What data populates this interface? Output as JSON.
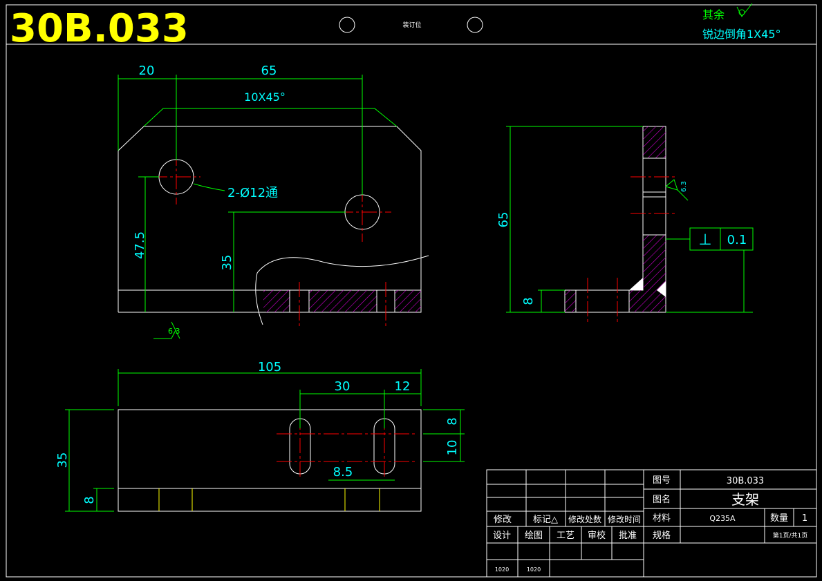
{
  "drawing_number_large": "30B.033",
  "binding_label": "装订位",
  "notes": {
    "surface_finish_label": "其余",
    "chamfer_note": "锐边倒角1X45°"
  },
  "front_view": {
    "dim_20": "20",
    "dim_65": "65",
    "chamfer_label": "10X45°",
    "hole_callout": "2-Ø12通",
    "dim_47_5": "47.5",
    "dim_35": "35",
    "roughness": "6.3"
  },
  "side_view": {
    "dim_65": "65",
    "dim_8": "8",
    "roughness": "6.3",
    "tolerance_symbol": "⊥",
    "tolerance_value": "0.1"
  },
  "top_view": {
    "dim_105": "105",
    "dim_30": "30",
    "dim_12": "12",
    "dim_35": "35",
    "dim_8_left": "8",
    "dim_8_right": "8",
    "dim_10": "10",
    "dim_8_5": "8.5"
  },
  "title_block": {
    "drawing_no_label": "图号",
    "drawing_no": "30B.033",
    "name_label": "图名",
    "name": "支架",
    "material_label": "材料",
    "material": "Q235A",
    "qty_label": "数量",
    "qty": "1",
    "spec_label": "规格",
    "page_info": "第1页/共1页",
    "rev_labels": [
      "修改",
      "标记△",
      "修改处数",
      "修改时间"
    ],
    "sign_labels": [
      "设计",
      "绘图",
      "工艺",
      "审校",
      "批准"
    ],
    "design_value": "1020",
    "draw_value": "1020"
  }
}
